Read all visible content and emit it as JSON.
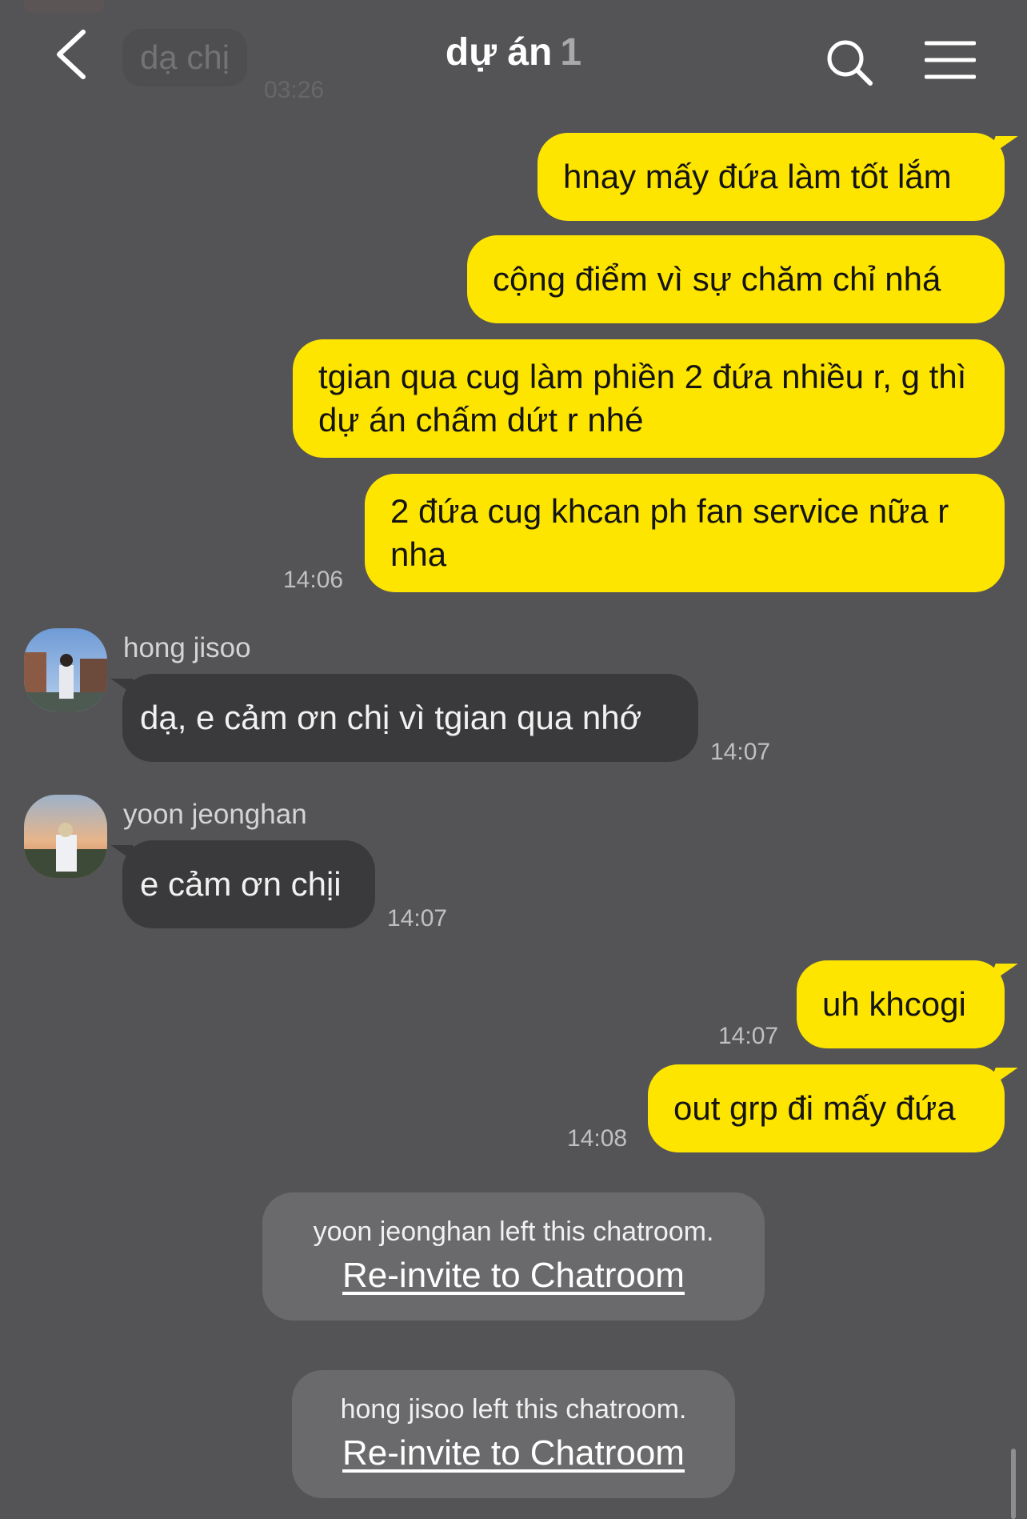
{
  "previous": {
    "text": "dạ chị",
    "time": "03:26"
  },
  "header": {
    "title": "dự án",
    "count": "1"
  },
  "messages": {
    "me_block1": [
      "hnay mấy đứa làm tốt lắm",
      "cộng điểm vì sự chăm chỉ nhá",
      "tgian qua cug làm phiền 2 đứa nhiều r, g thì dự án chấm dứt r nhé",
      "2 đứa cug khcan ph fan service nữa r nha"
    ],
    "me_block1_time": "14:06",
    "hong": {
      "name": "hong jisoo",
      "text": "dạ, e cảm ơn chị vì tgian qua nhớ",
      "time": "14:07"
    },
    "yoon": {
      "name": "yoon jeonghan",
      "text": "e cảm ơn chịi",
      "time": "14:07"
    },
    "me_block2": {
      "text1": "uh khcogi",
      "time1": "14:07",
      "text2": "out grp đi mấy đứa",
      "time2": "14:08"
    }
  },
  "notices": [
    {
      "text": "yoon jeonghan left this chatroom.",
      "link": "Re-invite to Chatroom"
    },
    {
      "text": "hong jisoo left this chatroom.",
      "link": "Re-invite to Chatroom"
    }
  ],
  "colors": {
    "background": "#545456",
    "my_bubble": "#fee500",
    "other_bubble": "#3a3a3c"
  }
}
